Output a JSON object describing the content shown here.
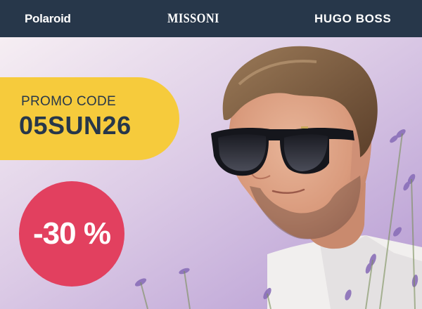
{
  "brands": {
    "polaroid": "Polaroid",
    "missoni": "MISSONI",
    "hugo_boss": "HUGO BOSS"
  },
  "promo": {
    "label": "PROMO CODE",
    "code": "05SUN26"
  },
  "discount": {
    "text": "-30 %"
  },
  "colors": {
    "header_bg": "#27374a",
    "promo_bg": "#f6cb3c",
    "promo_text": "#27374a",
    "discount_bg": "#e2405f"
  }
}
